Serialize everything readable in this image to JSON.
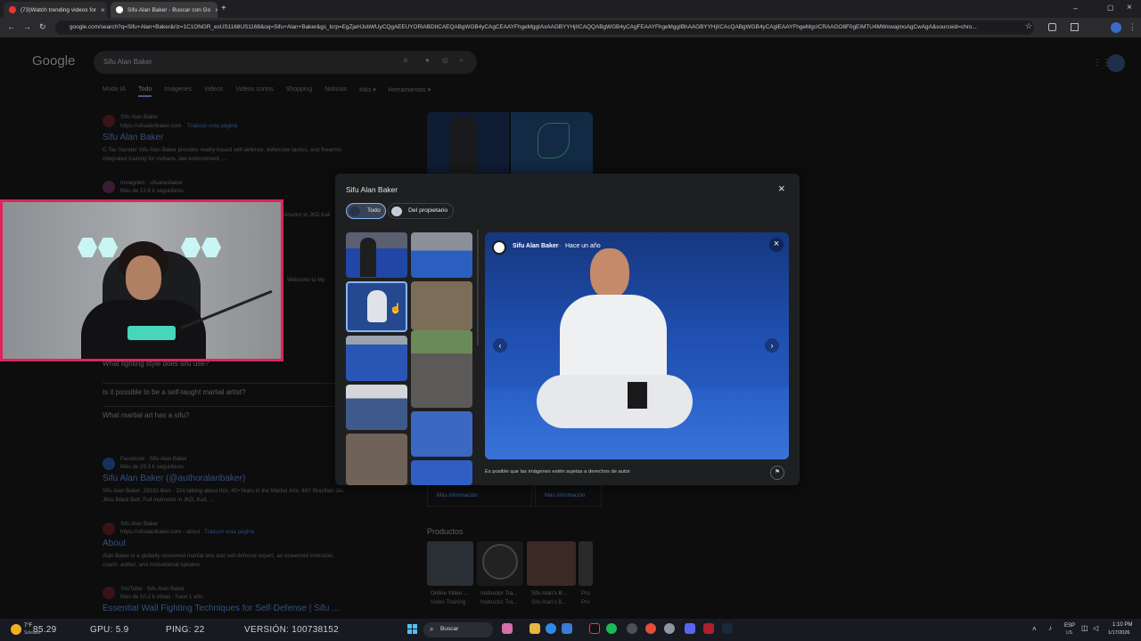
{
  "browser": {
    "tabs": [
      {
        "label": "(73)Watch trending videos for"
      },
      {
        "label": "Sifu Alan Baker - Buscar con Go"
      }
    ],
    "url": "google.com/search?q=Sifu+Alan+Baker&rlz=1C1ONGR_esUS1168US1168&oq=Sifu+Alan+Baker&gs_lcrp=EgZjaHJvbWUyCQgAEEUYORiABDIICAEQABgWGB4yCAgCEAAYFhgeMggIAxAAGBYYHjIICAQQABgWGB4yCAgFEAAYFhgeMggIBhAAGBYYHjIICAcQABgWGB4yCAgIEAAYFhgeMgcICRAAGO8F0gEIMTU4MWowajmoAgCwAgA&sourceid=chro..."
  },
  "google": {
    "logo": "Google",
    "query": "Sifu Alan Baker",
    "tabs": [
      "Modo IA",
      "Todo",
      "Imágenes",
      "Videos",
      "Videos cortos",
      "Shopping",
      "Noticias",
      "Más ▾",
      "Herramientas ▾"
    ],
    "results": [
      {
        "site": "Sifu Alan Baker",
        "url": "https://sifualanbaker.com",
        "translate": "Traducir esta página",
        "title": "Sifu Alan Baker",
        "snippet1": "C-Tac founder Sifu Alan Baker provides reality-based self-defense, defensive tactics, and firearms-",
        "snippet2": "integrated training for civilians, law enforcement, ..."
      },
      {
        "site": "Instagram · sifualanbaker",
        "url": "Más de 12.8 k seguidores"
      }
    ],
    "paa": [
      "What fighting style does sifu use?",
      "Is it possible to be a self-taught martial artist?",
      "What martial art has a sifu?"
    ],
    "facebook": {
      "site": "Facebook · Sifu Alan Baker",
      "url": "Más de 29.3 k seguidores",
      "title": "Sifu Alan Baker (@authoralanbaker)",
      "snippet1": "Sifu Alan Baker. 29333 likes · 324 talking about this. 45+Years in the Martial Arts. 4th° Brazilian Jiu-",
      "snippet2": "Jitsu Black Belt. Full instructor in JKD, Kali, ..."
    },
    "about": {
      "site": "Sifu Alan Baker",
      "url": "https://sifualanbaker.com › about",
      "translate": "Traducir esta página",
      "title": "About",
      "snippet1": "Alan Baker is a globally renowned martial arts and self-defense expert, an esteemed instructor,",
      "snippet2": "coach, author, and motivational speaker."
    },
    "youtube": {
      "site": "YouTube · Sifu Alan Baker",
      "url": "Más de 10.2 k vistas · hace 1 año",
      "title": "Essential Wall Fighting Techniques for Self-Defense | Sifu ..."
    },
    "side_snippets": [
      "structor in JKD Kali",
      "Welcome to My"
    ],
    "kp": {
      "more1": "Más información",
      "more2": "Más información",
      "products_title": "Productos",
      "products": [
        {
          "name": "Online Video ...",
          "seller": "Video Training"
        },
        {
          "name": "Instructor Tra...",
          "seller": "Instructor Tra..."
        },
        {
          "name": "Sifu Alan's B...",
          "seller": "Sifu Alan's B..."
        },
        {
          "name": "Pro",
          "seller": "Pro"
        }
      ]
    }
  },
  "modal": {
    "title": "Sifu Alan Baker",
    "chips": [
      "Todo",
      "Del propietario"
    ],
    "preview_source": "Sifu Alan Baker",
    "preview_time": "Hace un año",
    "copyright": "Es posible que las imágenes estén sujetas a derechos de autor"
  },
  "taskbar": {
    "stats": [
      "85.29",
      "GPU: 5.9",
      "PING: 22",
      "VERSIÓN: 100738152"
    ],
    "temp": "7°F",
    "temp_desc": "Soleado",
    "search": "Buscar",
    "lang": "ESP",
    "region": "US",
    "time": "1:10 PM",
    "date": "1/17/2026"
  },
  "colors": {
    "accent": "#8ab4f8",
    "cam_border": "#e0235a",
    "mat_blue": "#1f55b3"
  }
}
